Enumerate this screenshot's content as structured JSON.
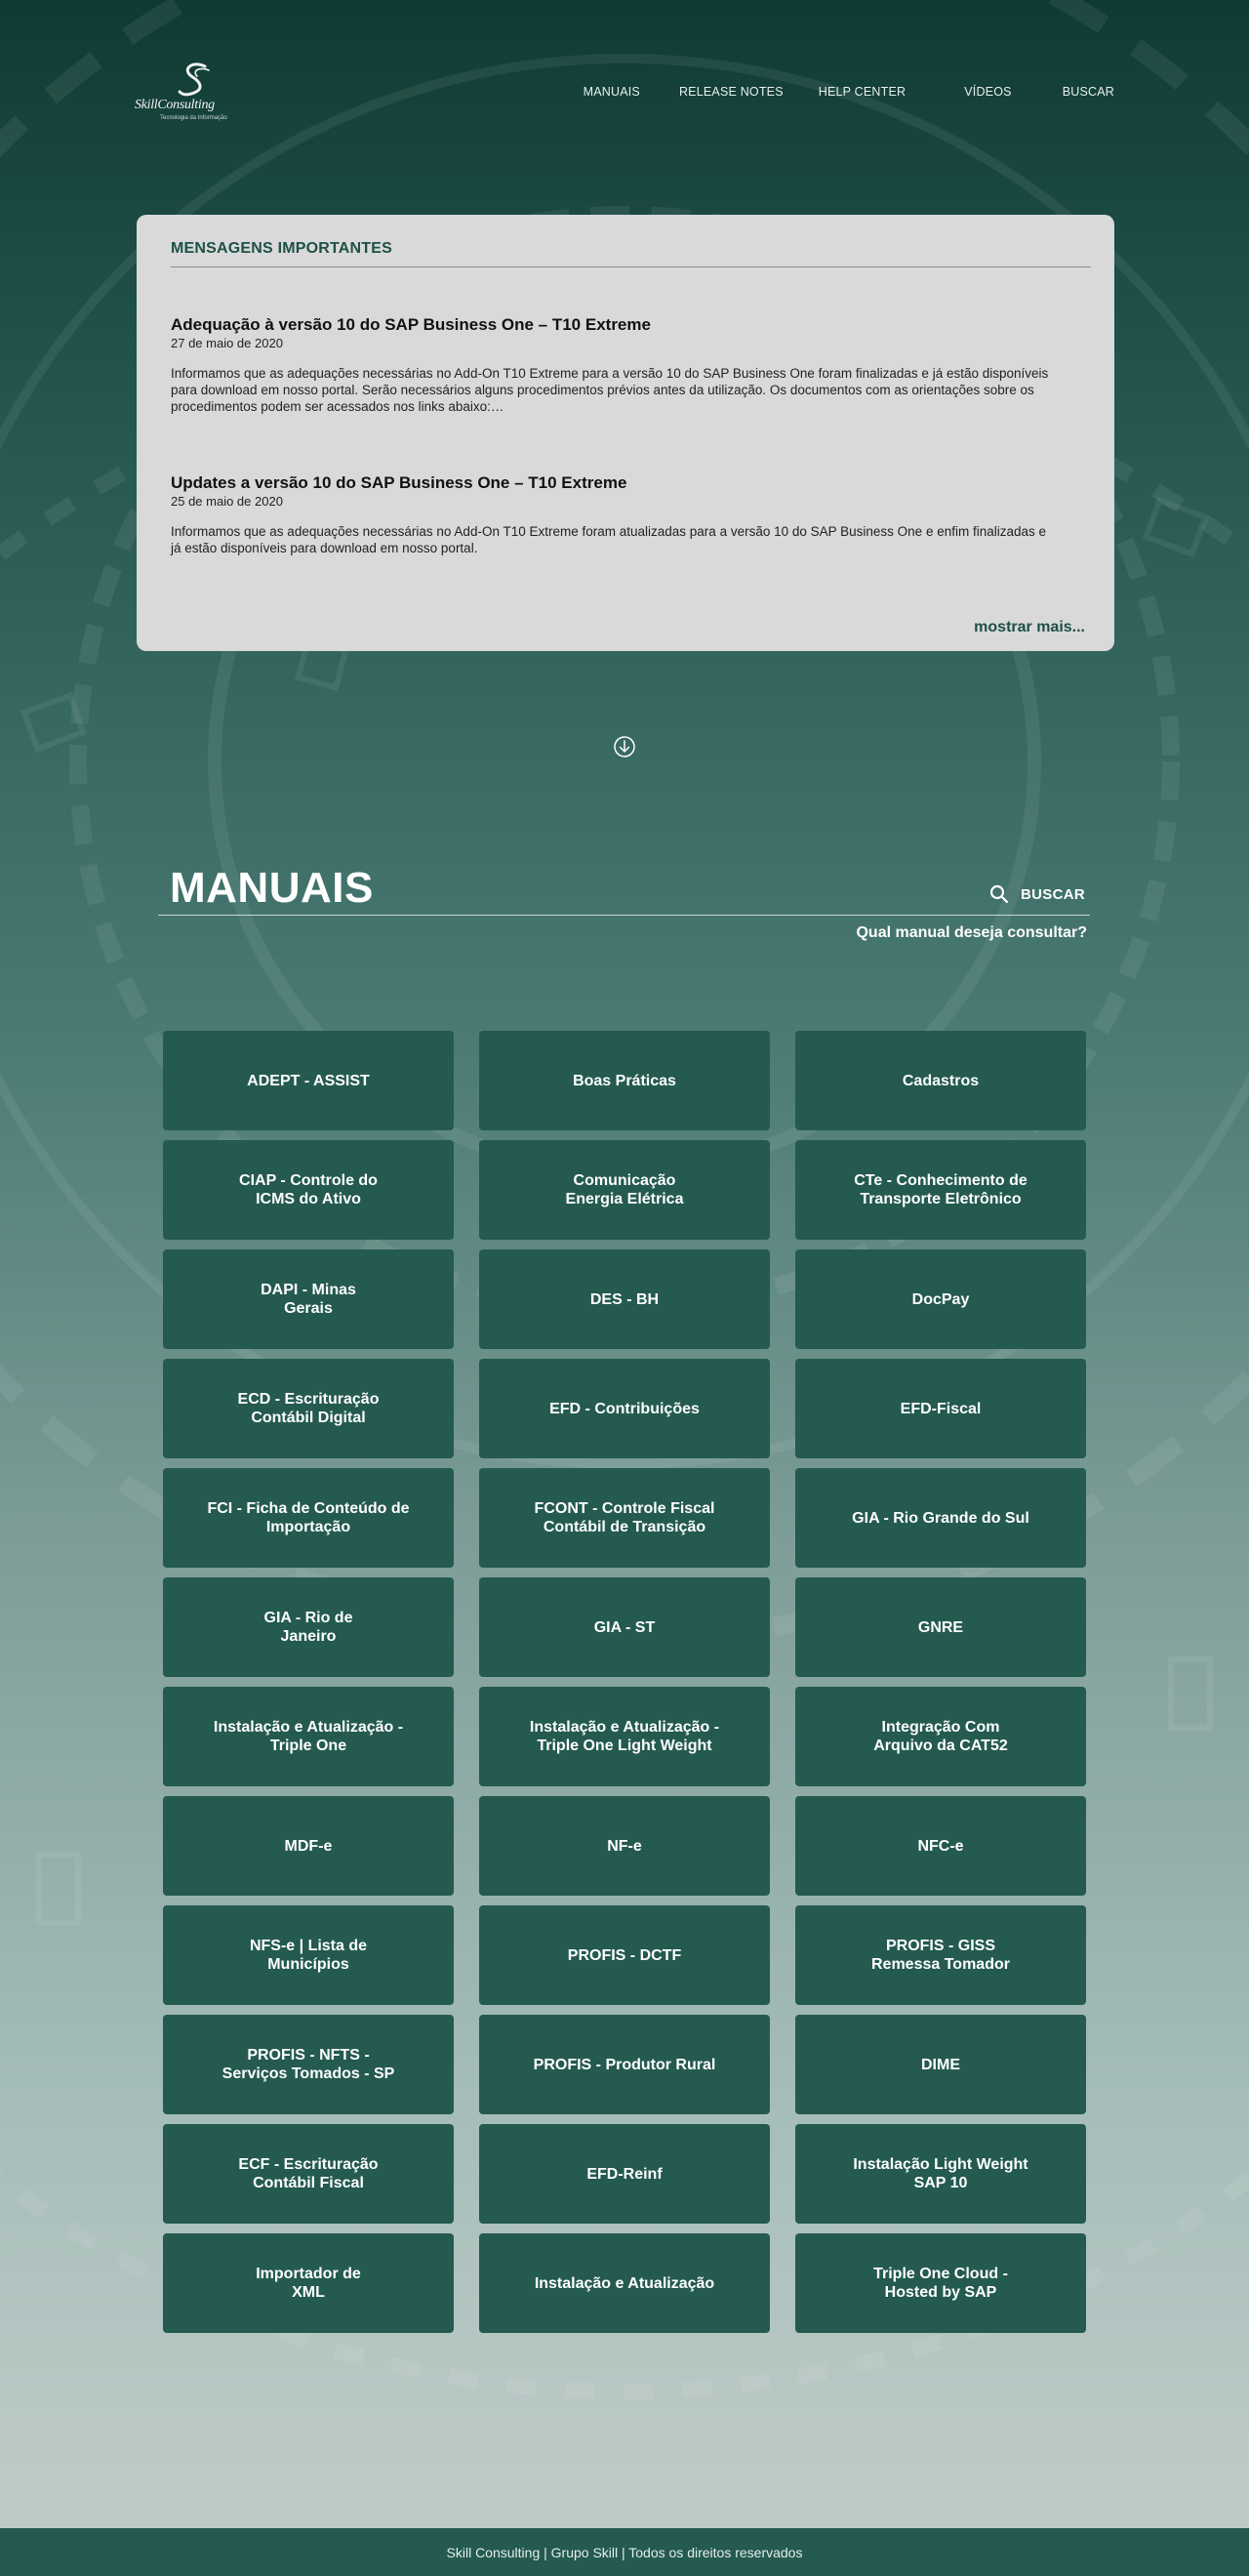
{
  "header": {
    "logo_text": "SkillConsulting",
    "logo_tagline": "Tecnologia da Informação",
    "nav": [
      "MANUAIS",
      "RELEASE NOTES",
      "HELP CENTER",
      "VÍDEOS",
      "BUSCAR"
    ]
  },
  "messages": {
    "title": "MENSAGENS IMPORTANTES",
    "items": [
      {
        "title": "Adequação à versão 10 do SAP Business One – T10 Extreme",
        "date": "27 de maio de 2020",
        "text": "Informamos que as adequações necessárias no Add-On T10 Extreme para a versão 10 do SAP Business One foram finalizadas e já estão disponíveis para download em nosso portal. Serão necessários alguns procedimentos prévios antes da utilização. Os documentos com as orientações sobre os procedimentos podem ser acessados nos links abaixo:…"
      },
      {
        "title": "Updates a versão 10 do SAP Business One – T10 Extreme",
        "date": "25 de maio de 2020",
        "text": "Informamos que as adequações necessárias no Add-On T10 Extreme foram atualizadas para a versão 10 do SAP Business One e enfim finalizadas e já estão disponíveis para download em nosso portal."
      }
    ],
    "more_label": "mostrar mais..."
  },
  "manuais": {
    "title": "MANUAIS",
    "search_label": "BUSCAR",
    "question": "Qual manual deseja consultar?",
    "cards": [
      "ADEPT - ASSIST",
      "Boas Práticas",
      "Cadastros",
      "CIAP - Controle do\nICMS do Ativo",
      "Comunicação\nEnergia Elétrica",
      "CTe - Conhecimento de\nTransporte Eletrônico",
      "DAPI - Minas\nGerais",
      "DES - BH",
      "DocPay",
      "ECD - Escrituração\nContábil Digital",
      "EFD - Contribuições",
      "EFD-Fiscal",
      "FCI - Ficha de Conteúdo de\nImportação",
      "FCONT - Controle Fiscal\nContábil de Transição",
      "GIA - Rio Grande do Sul",
      "GIA - Rio de\nJaneiro",
      "GIA - ST",
      "GNRE",
      "Instalação e Atualização -\nTriple One",
      "Instalação e Atualização -\nTriple One Light Weight",
      "Integração Com\nArquivo da CAT52",
      "MDF-e",
      "NF-e",
      "NFC-e",
      "NFS-e | Lista de\nMunicípios",
      "PROFIS - DCTF",
      "PROFIS - GISS\nRemessa Tomador",
      "PROFIS - NFTS -\nServiços Tomados - SP",
      "PROFIS - Produtor Rural",
      "DIME",
      "ECF - Escrituração\nContábil Fiscal",
      "EFD-Reinf",
      "Instalação Light Weight\nSAP 10",
      "Importador de\nXML",
      "Instalação e Atualização",
      "Triple One Cloud -\nHosted by SAP"
    ]
  },
  "footer": {
    "text": "Skill Consulting | Grupo Skill | Todos os direitos reservados"
  },
  "colors": {
    "accent": "#1d5046",
    "card": "#245a50",
    "panel": "#d9d9d9"
  }
}
